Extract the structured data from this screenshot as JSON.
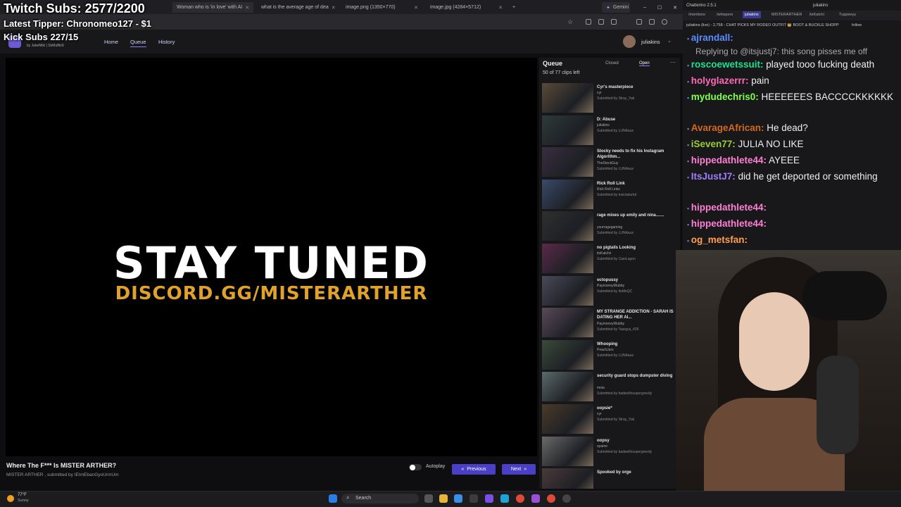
{
  "overlay": {
    "twitch_subs": "Twitch Subs: 2577/2200",
    "latest_tipper": "Latest Tipper: Chronomeo127 - $1",
    "kick_subs": "Kick Subs 227/15"
  },
  "browser": {
    "tabs": [
      {
        "label": "Woman who is 'in love' with AI"
      },
      {
        "label": "what is the average age of dea"
      },
      {
        "label": "image.png (1350×770)"
      },
      {
        "label": "image.jpg (4284×5712)"
      }
    ],
    "gemini_label": "Gemini"
  },
  "site": {
    "credits": "by JakeMiki | SirMuffin9",
    "nav": {
      "home": "Home",
      "queue": "Queue",
      "history": "History"
    },
    "user": "juliakins"
  },
  "player": {
    "headline": "STAY TUNED",
    "subline": "DISCORD.GG/MISTERARTHER",
    "clip_title": "Where The F*** Is MISTER ARTHER?",
    "clip_meta": "MISTER ARTHER , submitted by IEtmEbanGyoUrmUm",
    "autoplay_label": "Autoplay",
    "previous_label": "Previous",
    "next_label": "Next"
  },
  "queue": {
    "title": "Queue",
    "closed_label": "Closed",
    "open_label": "Open",
    "count": "50 of 77 clips left",
    "items": [
      {
        "title": "Cyr's masterpiece",
        "channel": "cyr",
        "submitter": "Submitted by Stray_Yak"
      },
      {
        "title": "D: Abuse",
        "channel": "juliakins",
        "submitter": "Submitted by LUNAaux"
      },
      {
        "title": "Stocky needs to fix his Instagram Algorithm...",
        "channel": "TheStockGuy",
        "submitter": "Submitted by LUNAaux"
      },
      {
        "title": "Rick Roll Link",
        "channel": "Rick Roll Links",
        "submitter": "Submitted by toxictaturtot"
      },
      {
        "title": "rage mixes up emily and nina.......",
        "channel": "yourragegaming",
        "submitter": "Submitted by LUNAaux"
      },
      {
        "title": "no pigtails Looking",
        "channel": "itsKatchii",
        "submitter": "Submitted by CaioLugon"
      },
      {
        "title": "octopussy",
        "channel": "PaymoneyWubby",
        "submitter": "Submitted by ItsMeQC"
      },
      {
        "title": "MY STRANGE ADDICTION - SARAH IS DATING HER AI...",
        "channel": "PaymoneyWubby",
        "submitter": "Submitted by Taargus_435"
      },
      {
        "title": "Whooping",
        "channel": "PeachJars",
        "submitter": "Submitted by LUNAaux"
      },
      {
        "title": "security guard stops dumpster diving",
        "channel": "moia",
        "submitter": "Submitted by badwolfxsupergreedy"
      },
      {
        "title": "oopsie*",
        "channel": "cyr",
        "submitter": "Submitted by Stray_Yak"
      },
      {
        "title": "oopsy",
        "channel": "ayame",
        "submitter": "Submitted by badwolfxsupergreedy"
      },
      {
        "title": "Spooked by orge",
        "channel": "",
        "submitter": ""
      }
    ]
  },
  "chatterino": {
    "app_title": "Chatterino 2.5.1",
    "channel_user": "juliakins",
    "tabs": [
      "/mentions",
      "/whispers",
      "juliakins",
      "MISTERARTHER",
      "itsKatchi",
      "Tuppeeyy"
    ],
    "stream_title": "juliakins (live) - 2,758 - CHAT PICKS MY RODEO OUTFIT 🤠 BOOT & BUCKLE SHOPP",
    "follow_label": "follow",
    "messages": [
      {
        "user": "ajrandall:",
        "text": "",
        "color": "#5b8cff"
      },
      {
        "user": "",
        "text": "Replying to @itsjustj7: this song pisses me off",
        "color": "#888888",
        "reply": true
      },
      {
        "user": "roscoewetssuit:",
        "text": " played tooo fucking death",
        "color": "#1fdf8f"
      },
      {
        "user": "holyglazerrr:",
        "text": " pain",
        "color": "#ff69b4"
      },
      {
        "user": "mydudechris0:",
        "text": " HEEEEEES BACCCCKKKKKK",
        "color": "#7fff4f"
      },
      {
        "user": "AvarageAfrican:",
        "text": " He dead? ",
        "color": "#d2691e"
      },
      {
        "user": "iSeven77:",
        "text": " JULIA NO LIKE",
        "color": "#9acd32"
      },
      {
        "user": "hippedathlete44:",
        "text": " AYEEE",
        "color": "#ff7fd4"
      },
      {
        "user": "ItsJustJ7:",
        "text": " did he get deported or something",
        "color": "#a07cff"
      },
      {
        "user": "hippedathlete44:",
        "text": "",
        "color": "#ff7fd4"
      },
      {
        "user": "hippedathlete44:",
        "text": "",
        "color": "#ff7fd4"
      },
      {
        "user": "og_metsfan:",
        "text": "",
        "color": "#ff9f4f"
      }
    ]
  },
  "taskbar": {
    "weather_temp": "77°F",
    "weather_cond": "Sunny",
    "search_label": "Search"
  }
}
